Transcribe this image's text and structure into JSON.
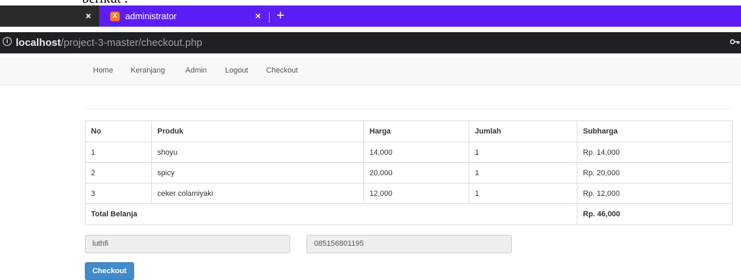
{
  "doc_text": "berikut :",
  "browser": {
    "inactive_tab_close": "×",
    "favicon_letter": "X",
    "active_tab_title": "administrator",
    "active_tab_close": "×",
    "new_tab": "+",
    "info_icon": "i",
    "url_host": "localhost",
    "url_path": "/project-3-master/checkout.php",
    "tab_bg": "#5c1ef5"
  },
  "nav": {
    "items": [
      "Home",
      "Keranjang",
      "Admin",
      "Logout",
      "Checkout"
    ]
  },
  "table": {
    "headers": [
      "No",
      "Produk",
      "Harga",
      "Jumlah",
      "Subharga"
    ],
    "rows": [
      [
        "1",
        "shoyu",
        "14,000",
        "1",
        "Rp. 14,000"
      ],
      [
        "2",
        "spicy",
        "20,000",
        "1",
        "Rp. 20,000"
      ],
      [
        "3",
        "ceker colamiyaki",
        "12,000",
        "1",
        "Rp. 12,000"
      ]
    ],
    "total_label": "Total Belanja",
    "total_value": "Rp. 46,000"
  },
  "form": {
    "name_value": "luthfi",
    "phone_value": "085156801195",
    "checkout_label": "Checkout",
    "button_color": "#428bca"
  }
}
